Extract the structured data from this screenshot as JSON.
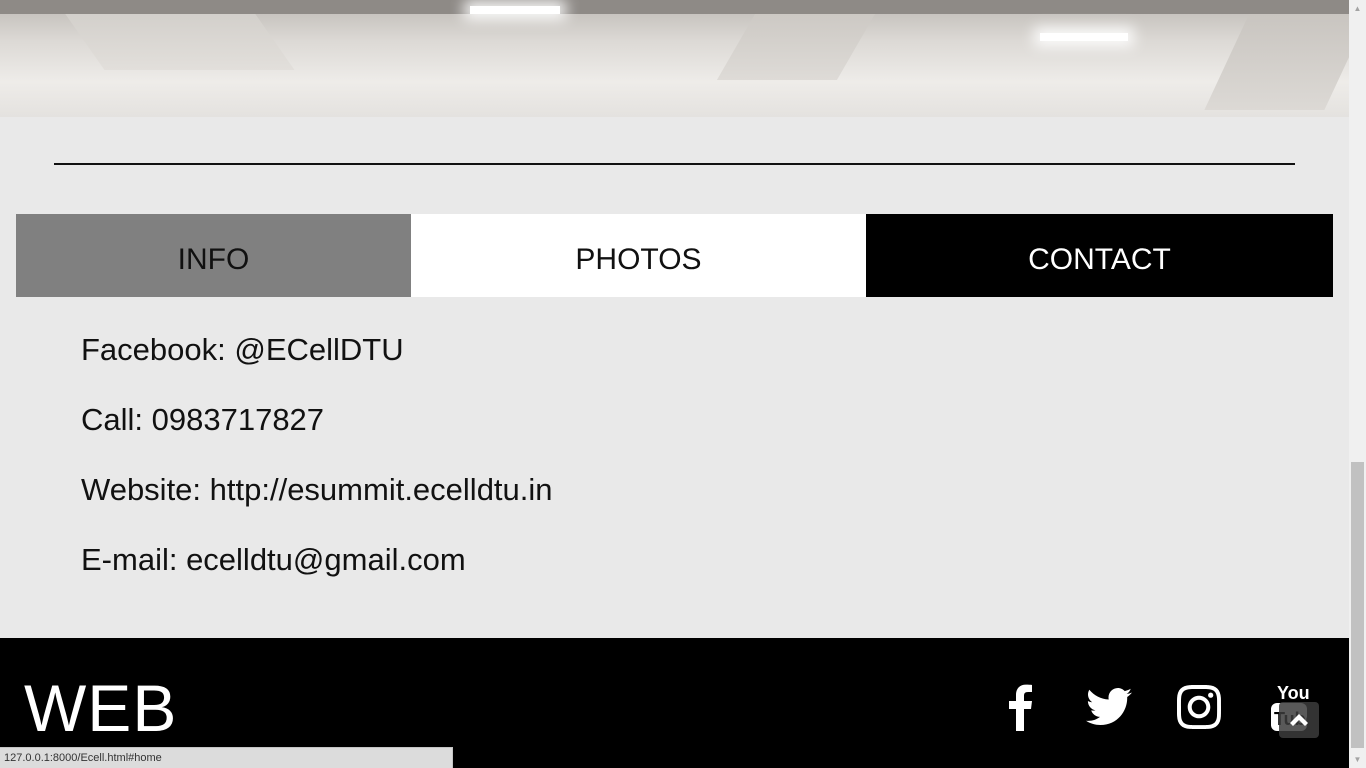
{
  "tabs": {
    "info": "INFO",
    "photos": "PHOTOS",
    "contact": "CONTACT"
  },
  "contact": {
    "facebook": "Facebook: @ECellDTU",
    "call": "Call: 0983717827",
    "website": "Website: http://esummit.ecelldtu.in",
    "email": "E-mail: ecelldtu@gmail.com"
  },
  "footer": {
    "logo": "WEB",
    "social": [
      "facebook-icon",
      "twitter-icon",
      "instagram-icon",
      "youtube-icon"
    ]
  },
  "status_bar": {
    "url": "127.0.0.1:8000/Ecell.html#home"
  },
  "colors": {
    "tab_info_bg": "#808080",
    "tab_photos_bg": "#ffffff",
    "tab_contact_bg": "#000000",
    "page_bg": "#e9e9e9",
    "footer_bg": "#000000"
  }
}
